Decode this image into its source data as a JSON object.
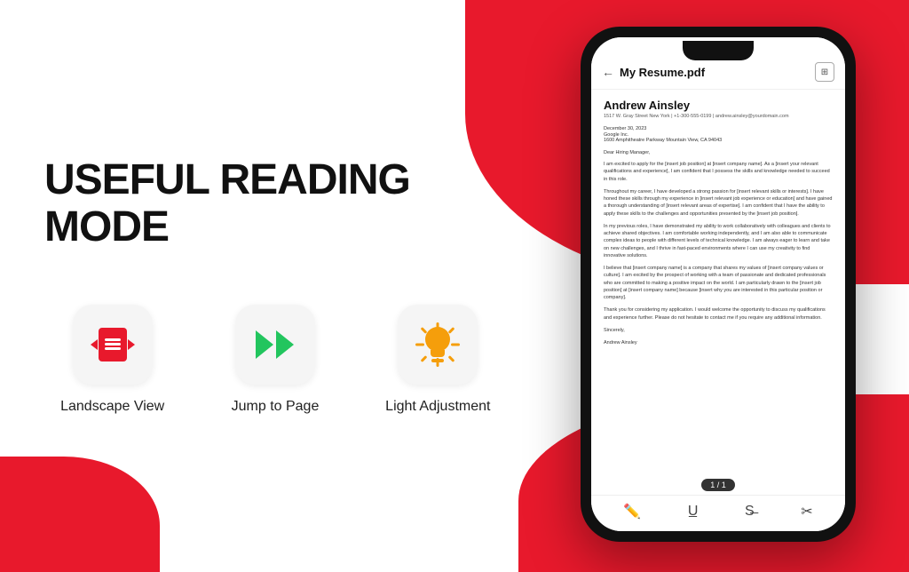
{
  "background": {
    "primary_color": "#e8192c",
    "secondary_color": "#ffffff"
  },
  "main_title": "USEFUL READING MODE",
  "features": [
    {
      "id": "landscape",
      "label": "Landscape View",
      "icon": "landscape-icon"
    },
    {
      "id": "jump",
      "label": "Jump to Page",
      "icon": "jump-icon"
    },
    {
      "id": "light",
      "label": "Light Adjustment",
      "icon": "light-icon"
    }
  ],
  "phone": {
    "title": "My Resume.pdf",
    "resume": {
      "name": "Andrew Ainsley",
      "contact": "1517 W. Gray Street  New York | +1-300-555-0199 | andrew.ainsley@yourdomain.com",
      "date": "December 30, 2023",
      "company_name": "Google Inc.",
      "company_address": "1600 Amphitheatre Parkway Mountain View, CA 94043",
      "greeting": "Dear Hiring Manager,",
      "body1": "I am excited to apply for the [insert job position] at [insert company name]. As a [insert your relevant qualifications and experience], I am confident that I possess the skills and knowledge needed to succeed in this role.",
      "body2": "Throughout my career, I have developed a strong passion for [insert relevant skills or interests]. I have honed these skills through my experience in [insert relevant job experience or education] and have gained a thorough understanding of [insert relevant areas of expertise]. I am confident that I have the ability to apply these skills to the challenges and opportunities presented by the [insert job position].",
      "body3": "In my previous roles, I have demonstrated my ability to work collaboratively with colleagues and clients to achieve shared objectives. I am comfortable working independently, and I am also able to communicate complex ideas to people with different levels of technical knowledge. I am always eager to learn and take on new challenges, and I thrive in fast-paced environments where I can use my creativity to find innovative solutions.",
      "body4": "I believe that [insert company name] is a company that shares my values of [insert company values or culture]. I am excited by the prospect of working with a team of passionate and dedicated professionals who are committed to making a positive impact on the world. I am particularly drawn to the [insert job position] at [insert company name] because [insert why you are interested in this particular position or company].",
      "body5": "Thank you for considering my application. I would welcome the opportunity to discuss my qualifications and experience further. Please do not hesitate to contact me if you require any additional information.",
      "closing": "Sincerely,",
      "signature": "Andrew Ainsley"
    },
    "page_indicator": "1 / 1",
    "toolbar_icons": [
      "pen",
      "underline",
      "strikethrough",
      "scissors"
    ]
  }
}
